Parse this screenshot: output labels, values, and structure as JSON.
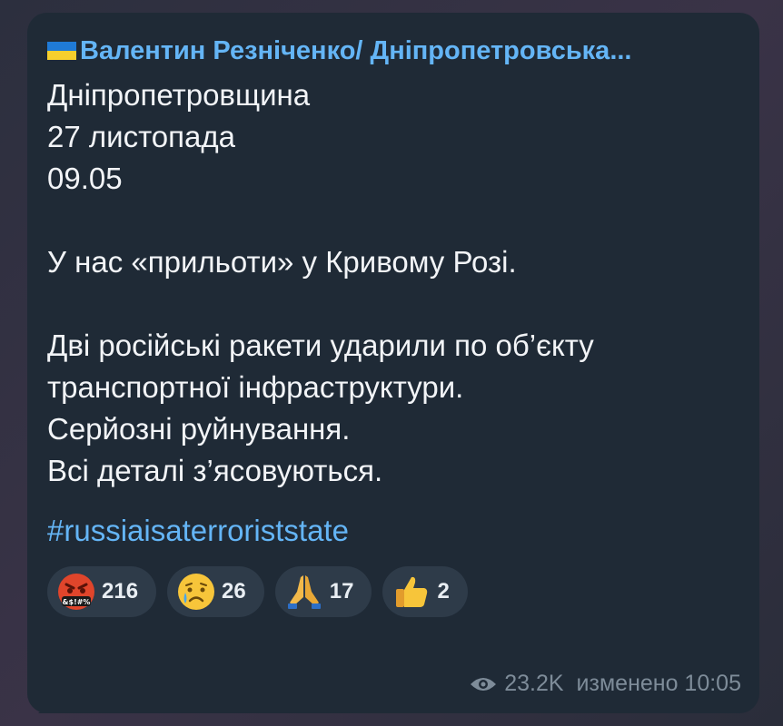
{
  "post": {
    "sender": "Валентин Резніченко/ Дніпропетровська...",
    "lines": [
      "Дніпропетровщина",
      "27 листопада",
      "09.05",
      "",
      "У нас «прильоти» у Кривому Розі.",
      "",
      "Дві російські ракети ударили по об’єкту",
      "транспортної інфраструктури.",
      "Серйозні руйнування.",
      "Всі деталі з’ясовуються."
    ],
    "hashtag": "#russiaisaterroriststate"
  },
  "reactions": [
    {
      "icon": "swearing-face-emoji",
      "count": "216"
    },
    {
      "icon": "crying-face-emoji",
      "count": "26"
    },
    {
      "icon": "folded-hands-emoji",
      "count": "17"
    },
    {
      "icon": "thumbs-up-emoji",
      "count": "2"
    }
  ],
  "footer": {
    "views": "23.2K",
    "edited": "изменено 10:05"
  },
  "colors": {
    "bubble": "#1f2a36",
    "link": "#64b5f6",
    "text": "#f2f4f7",
    "meta": "#7e8c99"
  }
}
